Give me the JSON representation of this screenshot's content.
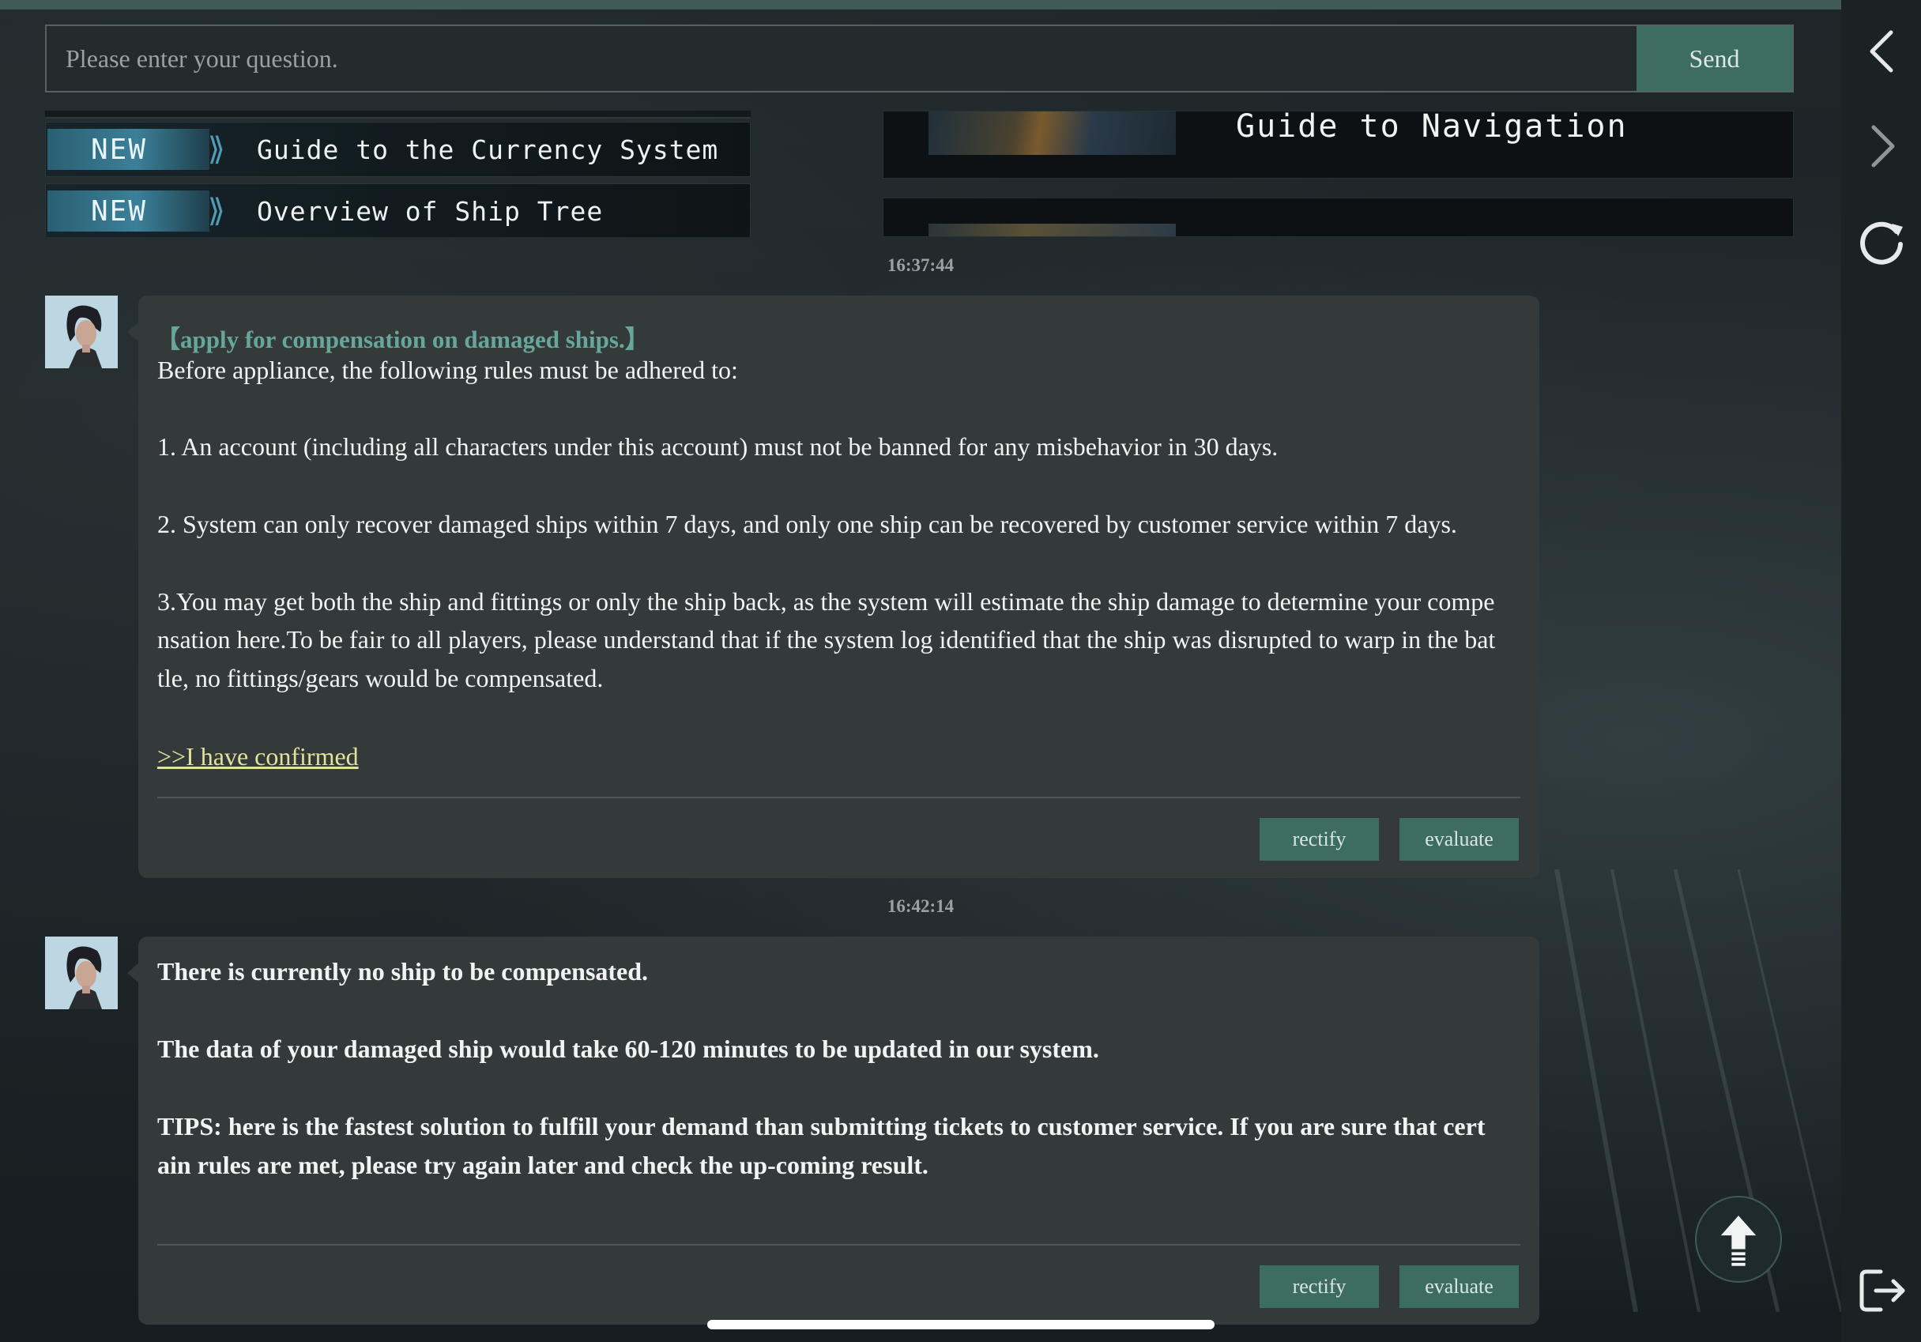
{
  "search": {
    "placeholder": "Please enter your question.",
    "send_label": "Send"
  },
  "guides": {
    "list": [
      {
        "tag": "NEW",
        "title": "Guide to the Currency System"
      },
      {
        "tag": "NEW",
        "title": "Overview of Ship Tree"
      }
    ],
    "featured_title": "Guide to Navigation"
  },
  "messages": [
    {
      "timestamp": "16:37:44",
      "heading": "【apply for compensation on damaged ships.】",
      "intro": " Before appliance, the following rules must be adhered to:",
      "rule1": "1. An account (including all characters under this account) must not be banned for any misbehavior in 30 days.",
      "rule2": "2. System can only recover damaged ships within 7 days, and only one ship can be recovered by customer service within 7 days.",
      "rule3_line1": "3.You may get both the ship and fittings or only the ship back, as the system will estimate the ship damage to determine your compe",
      "rule3_line2": "nsation here.To be fair to all players, please understand that if the system log identified that the ship was disrupted to warp in the bat",
      "rule3_line3": "tle, no fittings/gears would be compensated.",
      "link": ">>I have confirmed",
      "rectify_label": "rectify",
      "evaluate_label": "evaluate"
    },
    {
      "timestamp": "16:42:14",
      "line1": "There is currently no ship to be compensated.",
      "line2": "The data of your damaged ship would take 60-120 minutes to be updated in our system.",
      "tips_line1": "TIPS: here is the fastest solution to fulfill your demand than submitting tickets to customer service. If you are sure that cert",
      "tips_line2": "ain rules are met, please try again later and check the up-coming result.",
      "rectify_label": "rectify",
      "evaluate_label": "evaluate"
    }
  ],
  "sidebar_icons": [
    "back-arrow-icon",
    "forward-arrow-icon",
    "refresh-icon",
    "exit-icon"
  ],
  "colors": {
    "accent_button": "#3c6d60",
    "heading_teal": "#67a69a",
    "link_yellow": "#e3e29a",
    "bubble_bg": "#34393a"
  }
}
